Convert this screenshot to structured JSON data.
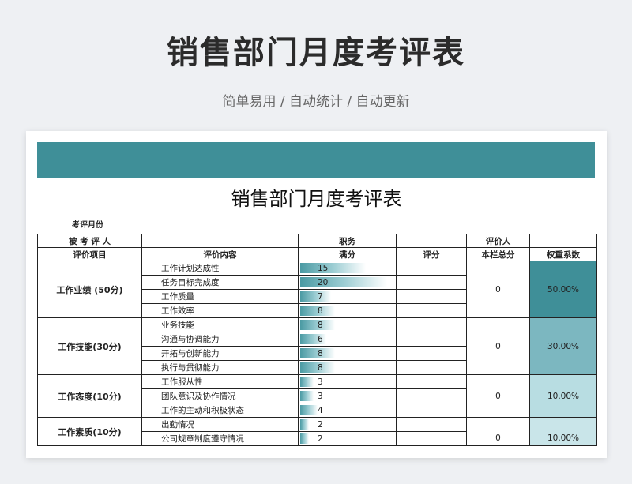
{
  "header": {
    "title": "销售部门月度考评表",
    "subtitle": "简单易用 / 自动统计 / 自动更新"
  },
  "sheet": {
    "title": "销售部门月度考评表",
    "month_label": "考评月份",
    "row1": {
      "evaluatee": "被 考 评 人",
      "position": "职务",
      "evaluator": "评价人"
    },
    "columns": [
      "评价项目",
      "评价内容",
      "满分",
      "评分",
      "本栏总分",
      "权重系数"
    ],
    "max_full_score": 20,
    "groups": [
      {
        "name": "工作业绩 (50分)",
        "total": "0",
        "weight": "50.00%",
        "items": [
          {
            "content": "工作计划达成性",
            "full": 15
          },
          {
            "content": "任务目标完成度",
            "full": 20
          },
          {
            "content": "工作质量",
            "full": 7
          },
          {
            "content": "工作效率",
            "full": 8
          }
        ]
      },
      {
        "name": "工作技能(30分)",
        "total": "0",
        "weight": "30.00%",
        "items": [
          {
            "content": "业务技能",
            "full": 8
          },
          {
            "content": "沟通与协调能力",
            "full": 6
          },
          {
            "content": "开拓与创新能力",
            "full": 8
          },
          {
            "content": "执行与贯彻能力",
            "full": 8
          }
        ]
      },
      {
        "name": "工作态度(10分)",
        "total": "0",
        "weight": "10.00%",
        "items": [
          {
            "content": "工作服从性",
            "full": 3
          },
          {
            "content": "团队意识及协作情况",
            "full": 3
          },
          {
            "content": "工作的主动和积极状态",
            "full": 4
          }
        ]
      },
      {
        "name": "工作素质(10分)",
        "total": "0",
        "weight": "10.00%",
        "items": [
          {
            "content": "出勤情况",
            "full": 2
          },
          {
            "content": "公司规章制度遵守情况",
            "full": 2
          }
        ]
      }
    ]
  },
  "colors": {
    "accent": "#3f8f98",
    "weight_50": "#3f8f98",
    "weight_30": "#7cb7c0",
    "weight_10": "#b8dde2",
    "page_bg": "#eef0f3"
  }
}
